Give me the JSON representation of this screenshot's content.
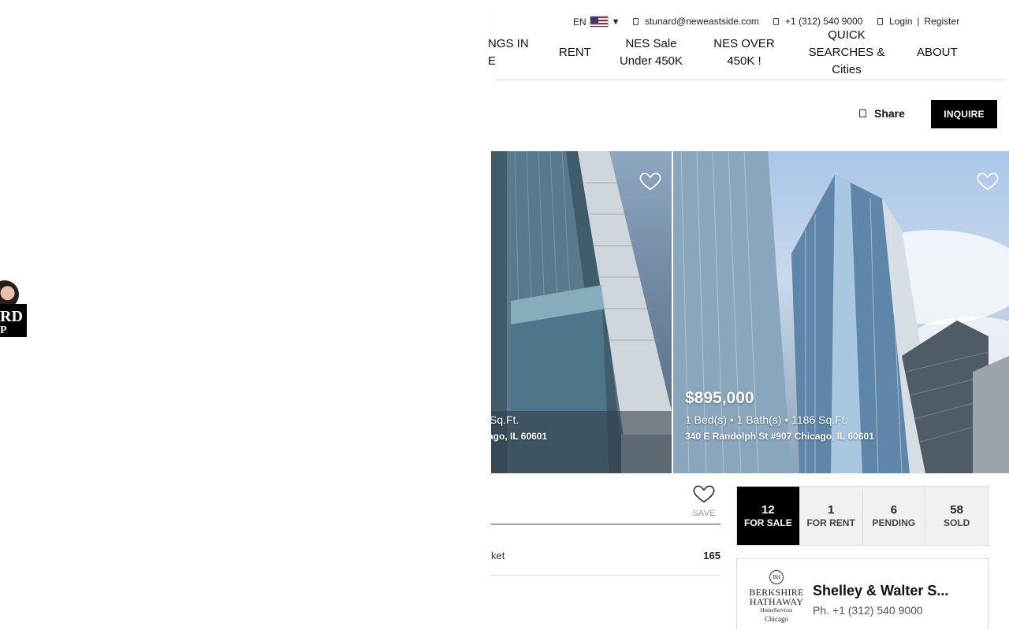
{
  "logo": {
    "text_line1": "RD",
    "text_line2": "P"
  },
  "header": {
    "language": "EN",
    "email": "stunard@neweastside.com",
    "phone": "+1 (312) 540 9000",
    "login": "Login",
    "separator": "|",
    "register": "Register"
  },
  "nav": [
    {
      "line1": "NGS IN",
      "line2": "E"
    },
    {
      "line1": "RENT"
    },
    {
      "line1": "NES Sale",
      "line2": "Under 450K"
    },
    {
      "line1": "NES OVER",
      "line2": "450K !"
    },
    {
      "line1": "QUICK",
      "line2": "SEARCHES &",
      "line3": "Cities"
    },
    {
      "line1": "ABOUT"
    }
  ],
  "actions": {
    "share": "Share",
    "inquire": "INQUIRE"
  },
  "listings": [
    {
      "specs": "Sq.Ft.",
      "address": "ago, IL 60601"
    },
    {
      "price": "$895,000",
      "beds": "1 Bed(s)",
      "baths": "1 Bath(s)",
      "sqft": "1186 Sq.Ft.",
      "address": "340 E Randolph St #907 Chicago, IL 60601"
    }
  ],
  "save": {
    "label": "SAVE"
  },
  "stat": {
    "label": "ket",
    "value": "165"
  },
  "counts": [
    {
      "num": "12",
      "label": "FOR SALE"
    },
    {
      "num": "1",
      "label": "FOR RENT"
    },
    {
      "num": "6",
      "label": "PENDING"
    },
    {
      "num": "58",
      "label": "SOLD"
    }
  ],
  "agent": {
    "brand_line1": "BERKSHIRE",
    "brand_line2": "HATHAWAY",
    "brand_line3": "HomeServices",
    "brand_line4": "Chicago",
    "name": "Shelley & Walter S...",
    "phone": "Ph. +1 (312) 540 9000"
  },
  "colors": {
    "accent": "#000000",
    "count_bg": "#f1f1f1",
    "muted": "#999999"
  }
}
